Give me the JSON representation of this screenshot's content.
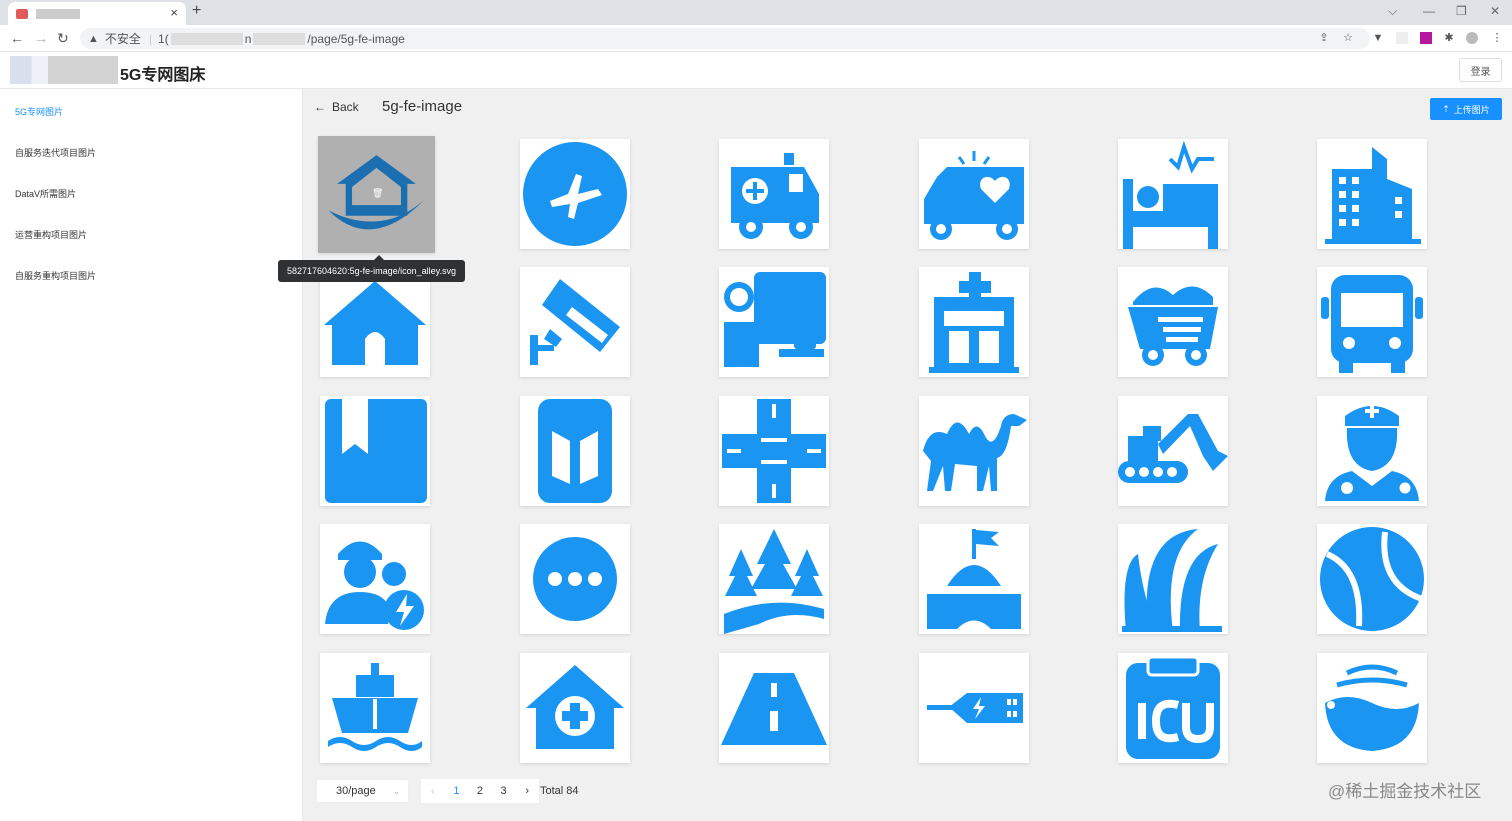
{
  "browser": {
    "tab_close": "×",
    "new_tab": "+",
    "security_label": "不安全",
    "url_prefix": "1(",
    "url_mid": "n",
    "url_path": "/page/5g-fe-image",
    "window_controls": [
      "⌵",
      "—",
      "❐",
      "✕"
    ]
  },
  "header": {
    "title": "5G专网图床",
    "login_label": "登录"
  },
  "sidebar": {
    "items": [
      {
        "label": "5G专网图片",
        "active": true
      },
      {
        "label": "自服务迭代项目图片",
        "active": false
      },
      {
        "label": "DataV所需图片",
        "active": false
      },
      {
        "label": "运营重构项目图片",
        "active": false
      },
      {
        "label": "自服务重构项目图片",
        "active": false
      }
    ]
  },
  "main": {
    "back_label": "Back",
    "back_arrow": "←",
    "page_name": "5g-fe-image",
    "upload_label": "上传图片",
    "upload_icon": "upload-icon",
    "tooltip": "582717604620:5g-fe-image/icon_alley.svg",
    "icon_color": "#1b95f2",
    "icons": [
      "house-logo",
      "airplane",
      "ambulance",
      "ambulance-heart",
      "hospital-bed",
      "buildings",
      "house",
      "cctv-camera",
      "sick-patient",
      "hospital",
      "ore-truck",
      "bus",
      "bookmark",
      "gate",
      "crossroads",
      "camel",
      "excavator",
      "doctor",
      "worker-power",
      "more",
      "forest",
      "hill-flag",
      "grass",
      "tennis-ball",
      "ship",
      "home-health",
      "road",
      "usb-charge",
      "icu",
      "water-drop"
    ]
  },
  "pagination": {
    "page_size": "30/page",
    "prev": "‹",
    "next": "›",
    "pages": [
      "1",
      "2",
      "3"
    ],
    "current": "1",
    "total": "Total 84"
  },
  "watermark": "@稀土掘金技术社区"
}
